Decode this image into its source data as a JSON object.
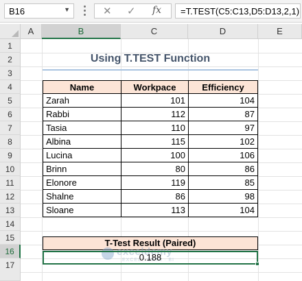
{
  "formula_bar": {
    "name_box": "B16",
    "cancel_icon": "✕",
    "enter_icon": "✓",
    "fx_icon": "fx",
    "formula": "=T.TEST(C5:C13,D5:D13,2,1)"
  },
  "columns": [
    "A",
    "B",
    "C",
    "D",
    "E"
  ],
  "selected_column": "B",
  "rows": [
    "1",
    "2",
    "3",
    "4",
    "5",
    "6",
    "7",
    "8",
    "9",
    "10",
    "11",
    "12",
    "13",
    "14",
    "15",
    "16",
    "17"
  ],
  "selected_row": "16",
  "sheet": {
    "title": "Using T.TEST Function",
    "table": {
      "headers": [
        "Name",
        "Workpace",
        "Efficiency"
      ],
      "rows": [
        [
          "Zarah",
          "101",
          "104"
        ],
        [
          "Rabbi",
          "112",
          "87"
        ],
        [
          "Tasia",
          "110",
          "97"
        ],
        [
          "Albina",
          "115",
          "102"
        ],
        [
          "Lucina",
          "100",
          "106"
        ],
        [
          "Brinn",
          "80",
          "86"
        ],
        [
          "Elonore",
          "119",
          "85"
        ],
        [
          "Shalne",
          "86",
          "98"
        ],
        [
          "Sloane",
          "113",
          "104"
        ]
      ]
    },
    "result_label": "T-Test Result (Paired)",
    "result_value": "0.188"
  },
  "watermark": {
    "name": "exceldemy",
    "tagline": "EXCEL · DATA · BI"
  },
  "colors": {
    "header_fill": "#fce4d6",
    "title_color": "#44546a",
    "selection_green": "#217346"
  }
}
